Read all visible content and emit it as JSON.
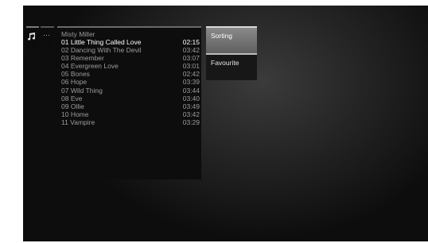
{
  "nav": {
    "music_icon": "music-note-icon",
    "more_icon": "more-icon",
    "more_label": "···"
  },
  "playlist": {
    "title": "Misty Miller",
    "tracks": [
      {
        "title": "01 Little Thing Called Love",
        "duration": "02:15",
        "selected": true
      },
      {
        "title": "02 Dancing With The Devil",
        "duration": "03:42",
        "selected": false
      },
      {
        "title": "03 Remember",
        "duration": "03:07",
        "selected": false
      },
      {
        "title": "04 Evergreen Love",
        "duration": "03:01",
        "selected": false
      },
      {
        "title": "05 Bones",
        "duration": "02:42",
        "selected": false
      },
      {
        "title": "06 Hope",
        "duration": "03:39",
        "selected": false
      },
      {
        "title": "07 Wild Thing",
        "duration": "03:44",
        "selected": false
      },
      {
        "title": "08 Eve",
        "duration": "03:40",
        "selected": false
      },
      {
        "title": "09 Ollie",
        "duration": "03:49",
        "selected": false
      },
      {
        "title": "10 Home",
        "duration": "03:42",
        "selected": false
      },
      {
        "title": "11 Vampire",
        "duration": "03:29",
        "selected": false
      }
    ]
  },
  "menu": {
    "sorting_label": "Sorting",
    "favourite_label": "Favourite"
  },
  "colors": {
    "selected_text": "#ffffff",
    "normal_text": "#9c9c9c",
    "menu_highlight": "#7a7a7a"
  }
}
